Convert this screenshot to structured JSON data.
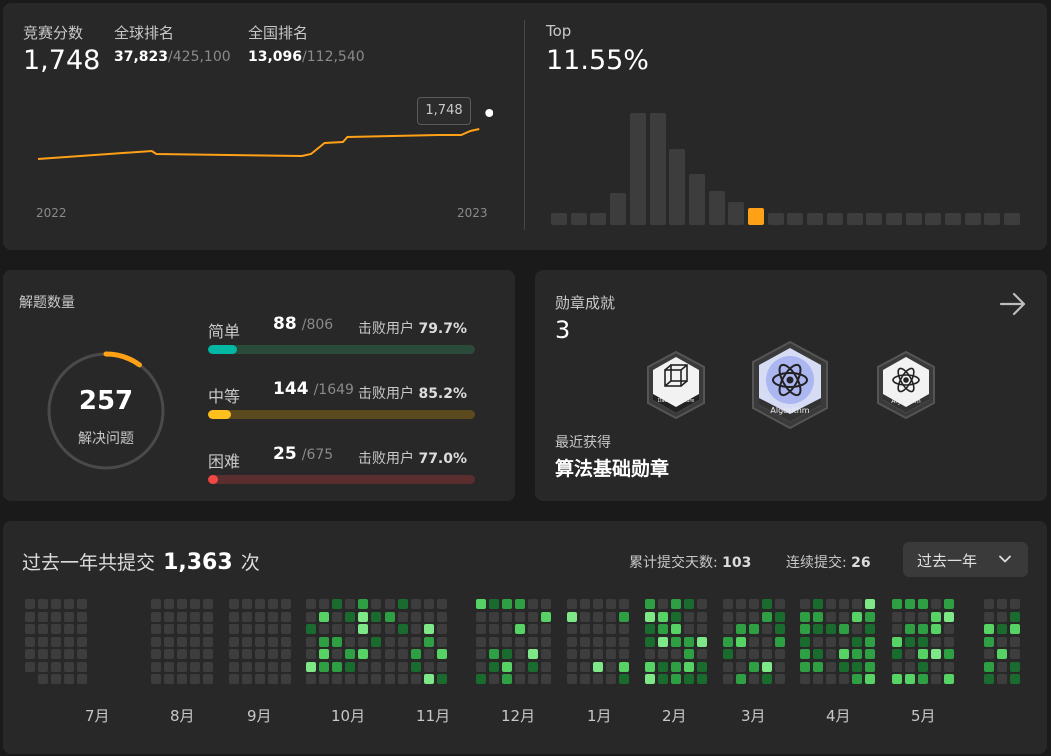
{
  "contest": {
    "score_label": "竞赛分数",
    "score": "1,748",
    "global_label": "全球排名",
    "global_rank": "37,823",
    "global_total": "/425,100",
    "national_label": "全国排名",
    "national_rank": "13,096",
    "national_total": "/112,540",
    "tooltip": "1,748",
    "year_start": "2022",
    "year_end": "2023",
    "rating_points": [
      [
        0,
        38
      ],
      [
        0.25,
        30
      ],
      [
        0.26,
        33
      ],
      [
        0.58,
        35
      ],
      [
        0.6,
        33
      ],
      [
        0.63,
        22
      ],
      [
        0.67,
        21
      ],
      [
        0.68,
        16
      ],
      [
        0.88,
        14
      ],
      [
        0.93,
        14
      ],
      [
        0.95,
        10
      ],
      [
        0.97,
        8
      ]
    ]
  },
  "top": {
    "label": "Top",
    "value": "11.55%",
    "histogram": [
      5,
      5,
      5,
      16,
      58,
      58,
      39,
      26,
      17,
      11,
      8,
      5,
      5,
      5,
      5,
      5,
      5,
      5,
      5,
      5,
      5,
      5,
      5,
      5
    ],
    "highlight_index": 10,
    "color_bar": "#3d3d3d",
    "color_highlight": "#ffa116"
  },
  "solved": {
    "title": "解题数量",
    "count": "257",
    "count_label": "解决问题",
    "progress_fraction": 0.1,
    "ring_color": "#ffa116",
    "difficulties": [
      {
        "name": "简单",
        "count": "88",
        "total": "/806",
        "beat_label": "击败用户",
        "beat": "79.7%",
        "fraction": 0.109,
        "color": "#00b8a3",
        "track": "#2a4a3a"
      },
      {
        "name": "中等",
        "count": "144",
        "total": "/1649",
        "beat_label": "击败用户",
        "beat": "85.2%",
        "fraction": 0.087,
        "color": "#ffc01e",
        "track": "#5a4a1e"
      },
      {
        "name": "困难",
        "count": "25",
        "total": "/675",
        "beat_label": "击败用户",
        "beat": "77.0%",
        "fraction": 0.037,
        "color": "#ef4743",
        "track": "#5a2e2e"
      }
    ]
  },
  "badges": {
    "title": "勋章成就",
    "count": "3",
    "arrow_icon": "arrow-right-icon",
    "items": [
      {
        "caption": "Data Structure",
        "icon": "cube-icon"
      },
      {
        "caption": "Algorithm",
        "icon": "atom-icon"
      },
      {
        "caption": "Algorithm",
        "icon": "atom-icon"
      }
    ],
    "recent_label": "最近获得",
    "recent_name": "算法基础勋章"
  },
  "submissions": {
    "prefix": "过去一年共提交",
    "count": "1,363",
    "suffix": "次",
    "days_label": "累计提交天数:",
    "days": "103",
    "streak_label": "连续提交:",
    "streak": "26",
    "range": "过去一年",
    "months": [
      "7月",
      "8月",
      "9月",
      "10月",
      "11月",
      "12月",
      "1月",
      "2月",
      "3月",
      "4月",
      "5月"
    ],
    "colors": {
      "empty": "#3d3d3d",
      "l1": "#196c2e",
      "l2": "#2ea043",
      "l3": "#56d364",
      "l4": "#7ee787"
    }
  }
}
